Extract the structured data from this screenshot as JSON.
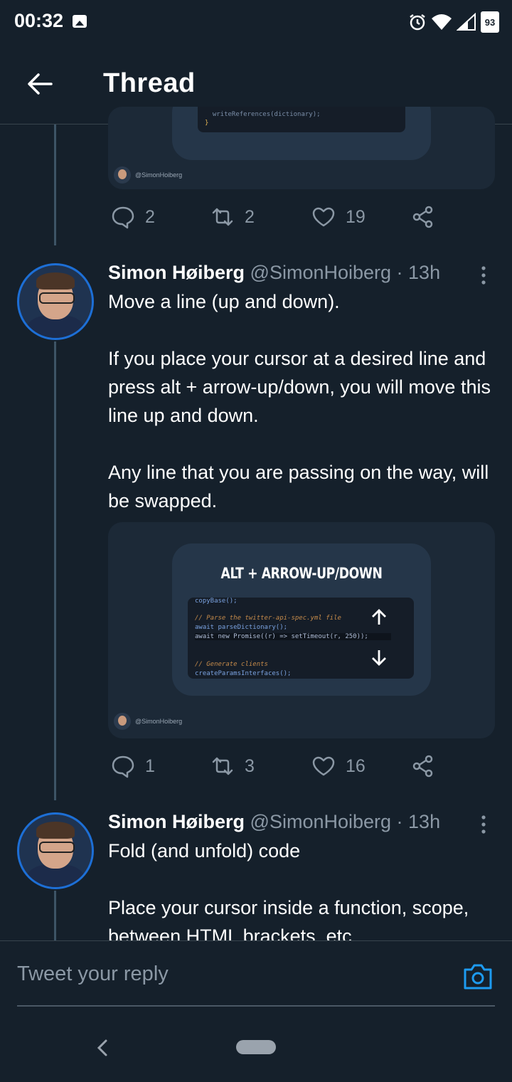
{
  "status": {
    "time": "00:32",
    "battery": "93"
  },
  "header": {
    "title": "Thread"
  },
  "top_media": {
    "code_line_1": "  writeReferences(dictionary);",
    "code_line_2": "}",
    "credit": "@SimonHoiberg"
  },
  "top_actions": {
    "replies": "2",
    "retweets": "2",
    "likes": "19"
  },
  "tweets": [
    {
      "name": "Simon Høiberg",
      "handle": "@SimonHoiberg",
      "time": "· 13h",
      "text": "Move a line (up and down).\n\nIf you place your cursor at a desired line and press alt + arrow-up/down, you will move this line up and down.\n\nAny line that you are passing on the way, will be swapped.",
      "media": {
        "title": "ALT + ARROW-UP/DOWN",
        "code": [
          "copyBase();",
          "",
          "// Parse the twitter-api-spec.yml file",
          "await parseDictionary();",
          "await new Promise((r) => setTimeout(r, 250));",
          "",
          "// Generate clients",
          "createParamsInterfaces();"
        ],
        "credit": "@SimonHoiberg"
      },
      "actions": {
        "replies": "1",
        "retweets": "3",
        "likes": "16"
      }
    },
    {
      "name": "Simon Høiberg",
      "handle": "@SimonHoiberg",
      "time": "· 13h",
      "text": "Fold (and unfold) code\n\nPlace your cursor inside a function, scope, between HTML brackets, etc."
    }
  ],
  "reply": {
    "placeholder": "Tweet your reply"
  },
  "icons": {
    "back": "arrow-left-icon",
    "reply": "speech-bubble-icon",
    "retweet": "retweet-icon",
    "like": "heart-icon",
    "share": "share-icon",
    "more": "more-vertical-icon",
    "camera": "camera-icon"
  },
  "colors": {
    "background": "#15202b",
    "accent": "#1d9bf0",
    "muted": "#8b98a5",
    "divider": "#38444d"
  }
}
